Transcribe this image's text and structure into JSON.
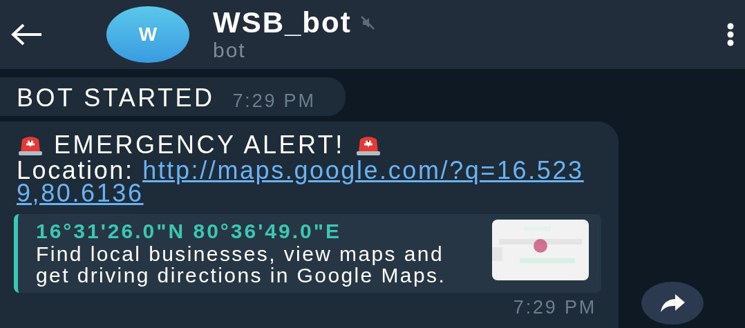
{
  "header": {
    "title": "WSB_bot",
    "subtitle": "bot",
    "avatar_letter": "W",
    "muted": true
  },
  "messages": [
    {
      "kind": "plain",
      "text": "BOT STARTED",
      "time": "7:29 PM"
    },
    {
      "kind": "alert",
      "title": "EMERGENCY ALERT!",
      "label": "Location:",
      "link": "http://maps.google.com/?q=16.5239,80.6136",
      "preview": {
        "title": "16°31'26.0\"N 80°36'49.0\"E",
        "description": "Find local businesses, view maps and get driving directions in Google Maps."
      },
      "time": "7:29 PM"
    }
  ]
}
